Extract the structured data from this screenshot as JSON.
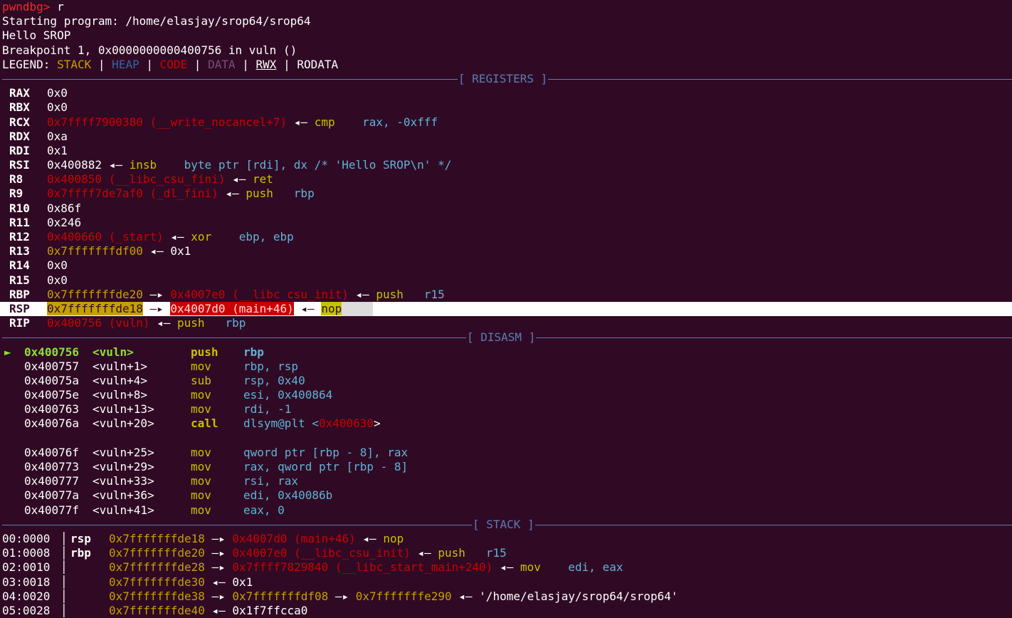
{
  "prompt": "pwndbg>",
  "command": "r",
  "output": [
    "Starting program: /home/elasjay/srop64/srop64",
    "Hello SROP",
    "Breakpoint 1, 0x0000000000400756 in vuln ()"
  ],
  "legend": {
    "label": "LEGEND:",
    "stack": "STACK",
    "heap": "HEAP",
    "code": "CODE",
    "data": "DATA",
    "rwx": "RWX",
    "rodata": "RODATA",
    "sep": "|"
  },
  "sections": {
    "registers": "[ REGISTERS ]",
    "disasm": "[ DISASM ]",
    "stack": "[ STACK ]"
  },
  "arrow_right": "—▸",
  "arrow_left": "◂—",
  "registers": [
    {
      "name": "RAX",
      "value": "0x0"
    },
    {
      "name": "RBX",
      "value": "0x0"
    },
    {
      "name": "RCX",
      "value": "0x7ffff7900380",
      "sym": "(__write_nocancel+7)",
      "ins": "cmp",
      "args": "rax, -0xfff"
    },
    {
      "name": "RDX",
      "value": "0xa"
    },
    {
      "name": "RDI",
      "value": "0x1"
    },
    {
      "name": "RSI",
      "value": "0x400882",
      "ins": "insb",
      "args": "byte ptr [rdi], dx /* 'Hello SROP\\n' */"
    },
    {
      "name": "R8",
      "value": "0x400850",
      "sym": "(__libc_csu_fini)",
      "ins": "ret"
    },
    {
      "name": "R9",
      "value": "0x7ffff7de7af0",
      "sym": "(_dl_fini)",
      "ins": "push",
      "args": "rbp"
    },
    {
      "name": "R10",
      "value": "0x86f"
    },
    {
      "name": "R11",
      "value": "0x246"
    },
    {
      "name": "R12",
      "value": "0x400660",
      "sym": "(_start)",
      "ins": "xor",
      "args": "ebp, ebp"
    },
    {
      "name": "R13",
      "value": "0x7fffffffdf00",
      "target": "0x1"
    },
    {
      "name": "R14",
      "value": "0x0"
    },
    {
      "name": "R15",
      "value": "0x0"
    },
    {
      "name": "RBP",
      "value": "0x7fffffffde20",
      "ptr": "0x4007e0",
      "sym": "(__libc_csu_init)",
      "ins": "push",
      "args": "r15"
    },
    {
      "name": "RSP",
      "value": "0x7fffffffde18",
      "ptr": "0x4007d0",
      "sym": "(main+46)",
      "ins": "nop"
    },
    {
      "name": "RIP",
      "value": "0x400756",
      "sym": "(vuln)",
      "ins": "push",
      "args": "rbp"
    }
  ],
  "disasm": [
    {
      "cur": true,
      "marker": "►",
      "addr": "0x400756",
      "sym": "<vuln>",
      "op": "push",
      "args": "rbp"
    },
    {
      "addr": "0x400757",
      "sym": "<vuln+1>",
      "op": "mov",
      "args": "rbp, rsp"
    },
    {
      "addr": "0x40075a",
      "sym": "<vuln+4>",
      "op": "sub",
      "args": "rsp, 0x40"
    },
    {
      "addr": "0x40075e",
      "sym": "<vuln+8>",
      "op": "mov",
      "args": "esi, 0x400864"
    },
    {
      "addr": "0x400763",
      "sym": "<vuln+13>",
      "op": "mov",
      "args": "rdi, -1"
    },
    {
      "addr": "0x40076a",
      "sym": "<vuln+20>",
      "op": "call",
      "args": "dlsym@plt <",
      "target": "0x400630",
      "close": ">"
    },
    {
      "blank": true
    },
    {
      "addr": "0x40076f",
      "sym": "<vuln+25>",
      "op": "mov",
      "args": "qword ptr [rbp - 8], rax"
    },
    {
      "addr": "0x400773",
      "sym": "<vuln+29>",
      "op": "mov",
      "args": "rax, qword ptr [rbp - 8]"
    },
    {
      "addr": "0x400777",
      "sym": "<vuln+33>",
      "op": "mov",
      "args": "rsi, rax"
    },
    {
      "addr": "0x40077a",
      "sym": "<vuln+36>",
      "op": "mov",
      "args": "edi, 0x40086b"
    },
    {
      "addr": "0x40077f",
      "sym": "<vuln+41>",
      "op": "mov",
      "args": "eax, 0"
    }
  ],
  "stack": [
    {
      "idx": "00:0000",
      "lbl": "rsp",
      "addr": "0x7fffffffde18",
      "ptr": "0x4007d0",
      "sym": "(main+46)",
      "ins": "nop"
    },
    {
      "idx": "01:0008",
      "lbl": "rbp",
      "addr": "0x7fffffffde20",
      "ptr": "0x4007e0",
      "sym": "(__libc_csu_init)",
      "ins": "push",
      "args": "r15"
    },
    {
      "idx": "02:0010",
      "lbl": "",
      "addr": "0x7fffffffde28",
      "ptr": "0x7ffff7829840",
      "sym": "(__libc_start_main+240)",
      "ins": "mov",
      "args": "edi, eax"
    },
    {
      "idx": "03:0018",
      "lbl": "",
      "addr": "0x7fffffffde30",
      "target": "0x1"
    },
    {
      "idx": "04:0020",
      "lbl": "",
      "addr": "0x7fffffffde38",
      "ptr2": "0x7fffffffdf08",
      "ptr3": "0x7fffffffe290",
      "str": "'/home/elasjay/srop64/srop64'"
    },
    {
      "idx": "05:0028",
      "lbl": "",
      "addr": "0x7fffffffde40",
      "target": "0x1f7ffcca0"
    }
  ]
}
